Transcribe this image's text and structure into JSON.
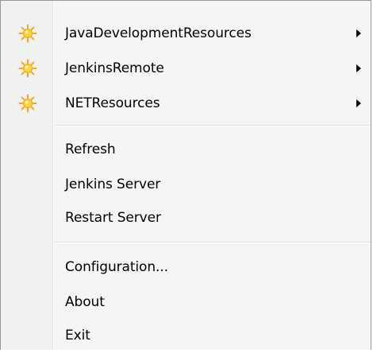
{
  "menu": {
    "submenus": [
      {
        "label": "JavaDevelopmentResources",
        "icon": "sun-icon"
      },
      {
        "label": "JenkinsRemote",
        "icon": "sun-icon"
      },
      {
        "label": "NETResources",
        "icon": "sun-icon"
      }
    ],
    "actions": [
      {
        "label": "Refresh"
      },
      {
        "label": "Jenkins Server"
      },
      {
        "label": "Restart Server"
      }
    ],
    "app_items": [
      {
        "label": "Configuration..."
      },
      {
        "label": "About"
      },
      {
        "label": "Exit"
      }
    ]
  },
  "colors": {
    "sun_core": "#ffd43a",
    "sun_rays": "#f2a91c",
    "arrow": "#000000"
  }
}
